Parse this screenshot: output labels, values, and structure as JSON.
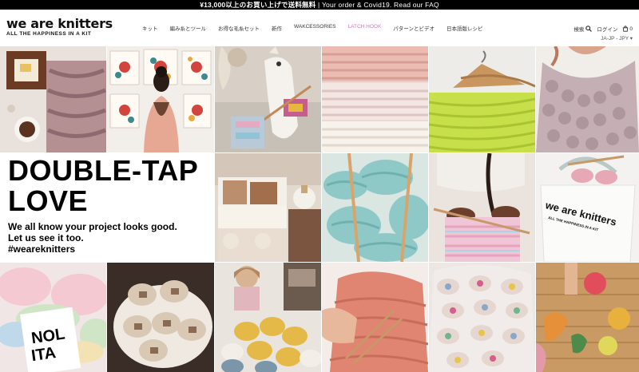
{
  "announcement": {
    "bold_text": "¥13,000以上のお買い上げで送料無料",
    "divider": "|",
    "text": "Your order & Covid19. Read our FAQ"
  },
  "header": {
    "logo": "we are knitters",
    "tagline": "ALL THE HAPPINESS IN A KIT",
    "nav": [
      {
        "label": "キット"
      },
      {
        "label": "編み糸とツール"
      },
      {
        "label": "お得な毛糸セット"
      },
      {
        "label": "新作"
      },
      {
        "label": "WAKCESSORIES"
      },
      {
        "label": "LATCH HOOK",
        "accent": true
      },
      {
        "label": "パターンとビデオ"
      },
      {
        "label": "日本語版レシピ"
      }
    ],
    "search_label": "検索",
    "login_label": "ログイン",
    "cart_count": "0",
    "locale": "JA-JP - JPY"
  },
  "promo": {
    "headline_1": "DOUBLE-TAP",
    "headline_2": "LOVE",
    "body_1": "We all know your project looks good.",
    "body_2": "Let us see it too.",
    "body_3": "#weareknitters"
  },
  "tiles": {
    "t11_logo": "NOL",
    "t11_logo_2": "ITA",
    "t10_tote_logo": "we are knitters",
    "t10_tote_tag": "ALL THE HAPPINESS IN A KIT"
  },
  "colors": {
    "accent": "#d07abf",
    "topbar": "#000000",
    "logo_text": "#111111"
  }
}
